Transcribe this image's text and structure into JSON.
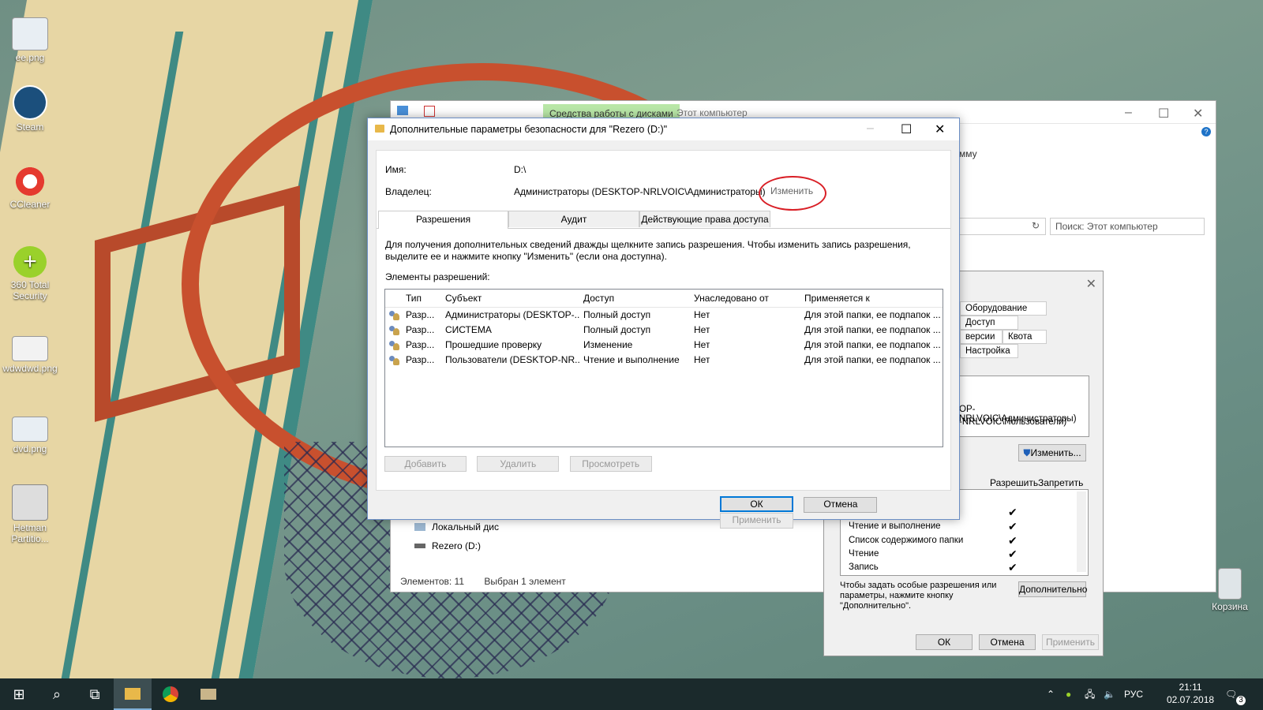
{
  "desktop": {
    "icons": [
      {
        "label": "ee.png"
      },
      {
        "label": "Steam"
      },
      {
        "label": "CCleaner"
      },
      {
        "label": "360 Total Security"
      },
      {
        "label": "wdwdwd.png"
      },
      {
        "label": "dvd.png"
      },
      {
        "label": "Hetman Partitio..."
      },
      {
        "label": "Корзина"
      }
    ]
  },
  "explorer": {
    "tools_tab": "Средства работы с дисками",
    "title": "Этот компьютер",
    "ribbon_text": "мму",
    "search_placeholder": "Поиск: Этот компьютер",
    "nav": [
      {
        "label": "Локальный дис"
      },
      {
        "label": "Rezero (D:)"
      }
    ],
    "status_items": "Элементов: 11",
    "status_selected": "Выбран 1 элемент"
  },
  "properties": {
    "tabs_row1": [
      "Оборудование",
      "Доступ"
    ],
    "tabs_row2": [
      "версии",
      "Квота",
      "Настройка"
    ],
    "groups": [
      "OP-NRLVOIC\\Администраторы)",
      "-NRLVOIC\\Пользователи)"
    ],
    "change_button": "Изменить...",
    "allow_label": "Разрешить",
    "deny_label": "Запретить",
    "permissions": [
      {
        "name": "Чтение и выполнение",
        "check": "✔"
      },
      {
        "name": "Список содержимого папки",
        "check": "✔"
      },
      {
        "name": "Чтение",
        "check": "✔"
      },
      {
        "name": "Запись",
        "check": "✔"
      }
    ],
    "extra_check": "✔",
    "advanced_hint": "Чтобы задать особые разрешения или параметры, нажмите кнопку \"Дополнительно\".",
    "advanced_button": "Дополнительно",
    "ok": "ОК",
    "cancel": "Отмена",
    "apply": "Применить"
  },
  "dialog": {
    "title": "Дополнительные параметры безопасности  для \"Rezero (D:)\"",
    "name_label": "Имя:",
    "name_value": "D:\\",
    "owner_label": "Владелец:",
    "owner_value": "Администраторы (DESKTOP-NRLVOIC\\Администраторы)",
    "owner_change": "Изменить",
    "tabs": [
      "Разрешения",
      "Аудит",
      "Действующие права доступа"
    ],
    "info_text": "Для получения дополнительных сведений дважды щелкните запись разрешения. Чтобы изменить запись разрешения, выделите ее и нажмите кнопку \"Изменить\" (если она доступна).",
    "entries_label": "Элементы разрешений:",
    "columns": [
      "Тип",
      "Субъект",
      "Доступ",
      "Унаследовано от",
      "Применяется к"
    ],
    "rows": [
      {
        "type": "Разр...",
        "subject": "Администраторы (DESKTOP-...",
        "access": "Полный доступ",
        "inherited": "Нет",
        "applies": "Для этой папки, ее подпапок ..."
      },
      {
        "type": "Разр...",
        "subject": "СИСТЕМА",
        "access": "Полный доступ",
        "inherited": "Нет",
        "applies": "Для этой папки, ее подпапок ..."
      },
      {
        "type": "Разр...",
        "subject": "Прошедшие проверку",
        "access": "Изменение",
        "inherited": "Нет",
        "applies": "Для этой папки, ее подпапок ..."
      },
      {
        "type": "Разр...",
        "subject": "Пользователи (DESKTOP-NR...",
        "access": "Чтение и выполнение",
        "inherited": "Нет",
        "applies": "Для этой папки, ее подпапок ..."
      }
    ],
    "add": "Добавить",
    "remove": "Удалить",
    "view": "Просмотреть",
    "ok": "ОК",
    "cancel": "Отмена",
    "apply": "Применить"
  },
  "taskbar": {
    "language": "РУС",
    "time": "21:11",
    "date": "02.07.2018",
    "notifications": "3"
  }
}
